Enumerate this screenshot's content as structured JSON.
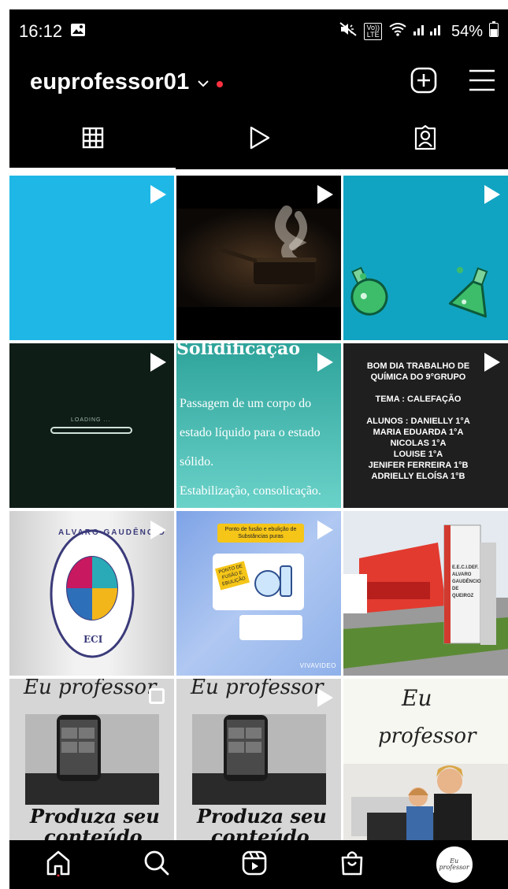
{
  "status_bar": {
    "time": "16:12",
    "lte_top": "Vo))",
    "lte_bottom": "LTE",
    "battery": "54%"
  },
  "header": {
    "username": "euprofessor01"
  },
  "tabs": [
    {
      "name": "posts-grid",
      "icon": "grid-icon",
      "active": true
    },
    {
      "name": "reels",
      "icon": "play-icon",
      "active": false
    },
    {
      "name": "tagged",
      "icon": "tagged-person-icon",
      "active": false
    }
  ],
  "posts": {
    "p4": {
      "text": "LOADING ..."
    },
    "p5": {
      "title": "Solidificação",
      "lines": [
        "Passagem de um corpo do",
        "estado líquido para o estado",
        "sólido.",
        "Estabilização, consolicação."
      ]
    },
    "p6": {
      "title": "BOM DIA TRABALHO DE QUÍMICA DO 9°GRUPO",
      "tema": "TEMA : CALEFAÇÃO",
      "alunos": [
        "ALUNOS : DANIELLY 1°A",
        "MARIA EDUARDA 1°A",
        "NICOLAS 1°A",
        "LOUISE 1°A",
        "JENIFER FERREIRA 1°B",
        "ADRIELLY ELOÍSA 1°B"
      ]
    },
    "p7": {
      "ring_text": "ALVARO GAUDÊNCIO",
      "base_text": "ECI"
    },
    "p8": {
      "banner": "Ponto de fusão e ebulição de Substâncias puras",
      "card": "PONTO DE FUSÃO E EBULIÇÃO",
      "watermark": "VIVAVIDEO"
    },
    "p9": {
      "sign": [
        "E.E.C.I.DEF.",
        "ALVARO",
        "GAUDÊNCIO",
        "DE QUEIROZ"
      ]
    },
    "p10": {
      "top": "Eu professor",
      "bottom1": "Produza seu",
      "bottom2": "conteúdo"
    },
    "p11": {
      "top": "Eu professor",
      "bottom1": "Produza seu",
      "bottom2": "conteúdo"
    },
    "p12": {
      "line1": "Eu",
      "line2": "professor"
    }
  },
  "bottom_nav": {
    "items": [
      "home-icon",
      "search-icon",
      "reels-icon",
      "shop-icon",
      "profile-avatar"
    ],
    "avatar_text": "Eu professor"
  },
  "colors": {
    "background": "#000000",
    "notification_dot": "#ff3040",
    "cyan": "#1fb8e6",
    "teal": "#11a4c2"
  }
}
